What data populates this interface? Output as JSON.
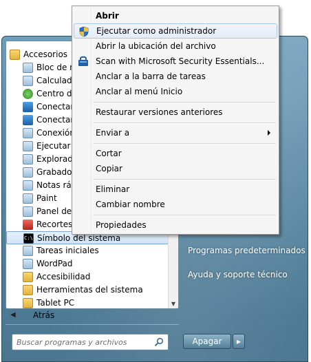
{
  "programs": [
    {
      "label": "Accesorios",
      "icon": "folder-icon",
      "indent": 0,
      "selected": false
    },
    {
      "label": "Bloc de notas",
      "icon": "notepad-icon",
      "indent": 1
    },
    {
      "label": "Calculadora",
      "icon": "calculator-icon",
      "indent": 1
    },
    {
      "label": "Centro de movilidad",
      "icon": "sync-icon",
      "indent": 1
    },
    {
      "label": "Conectarse a un proyector",
      "icon": "projector-icon",
      "indent": 1
    },
    {
      "label": "Conectarse a una red",
      "icon": "network-icon",
      "indent": 1
    },
    {
      "label": "Conexión a Escritorio remoto",
      "icon": "remote-desktop-icon",
      "indent": 1
    },
    {
      "label": "Ejecutar",
      "icon": "run-icon",
      "indent": 1
    },
    {
      "label": "Explorador de Windows",
      "icon": "explorer-icon",
      "indent": 1
    },
    {
      "label": "Grabadora de sonidos",
      "icon": "microphone-icon",
      "indent": 1
    },
    {
      "label": "Notas rápidas",
      "icon": "sticky-notes-icon",
      "indent": 1
    },
    {
      "label": "Paint",
      "icon": "paint-icon",
      "indent": 1
    },
    {
      "label": "Panel de entrada",
      "icon": "input-panel-icon",
      "indent": 1
    },
    {
      "label": "Recortes",
      "icon": "snipping-icon",
      "indent": 1
    },
    {
      "label": "Símbolo del sistema",
      "icon": "cmd-icon",
      "indent": 1,
      "selected": true
    },
    {
      "label": "Tareas iniciales",
      "icon": "getting-started-icon",
      "indent": 1
    },
    {
      "label": "WordPad",
      "icon": "wordpad-icon",
      "indent": 1
    },
    {
      "label": "Accesibilidad",
      "icon": "folder-icon",
      "indent": 1
    },
    {
      "label": "Herramientas del sistema",
      "icon": "folder-icon",
      "indent": 1
    },
    {
      "label": "Tablet PC",
      "icon": "folder-icon",
      "indent": 1
    }
  ],
  "back_label": "Atrás",
  "search": {
    "placeholder": "Buscar programas y archivos"
  },
  "right_links": [
    "Programas predeterminados",
    "Ayuda y soporte técnico"
  ],
  "shutdown_label": "Apagar",
  "context_menu": [
    {
      "label": "Abrir",
      "bold": true
    },
    {
      "label": "Ejecutar como administrador",
      "icon": "uac-shield-icon",
      "hover": true
    },
    {
      "label": "Abrir la ubicación del archivo"
    },
    {
      "label": "Scan with Microsoft Security Essentials...",
      "icon": "security-essentials-icon"
    },
    {
      "label": "Anclar a la barra de tareas"
    },
    {
      "label": "Anclar al menú Inicio"
    },
    {
      "sep": true
    },
    {
      "label": "Restaurar versiones anteriores"
    },
    {
      "sep": true
    },
    {
      "label": "Enviar a",
      "submenu": true
    },
    {
      "sep": true
    },
    {
      "label": "Cortar"
    },
    {
      "label": "Copiar"
    },
    {
      "sep": true
    },
    {
      "label": "Eliminar"
    },
    {
      "label": "Cambiar nombre"
    },
    {
      "sep": true
    },
    {
      "label": "Propiedades"
    }
  ]
}
